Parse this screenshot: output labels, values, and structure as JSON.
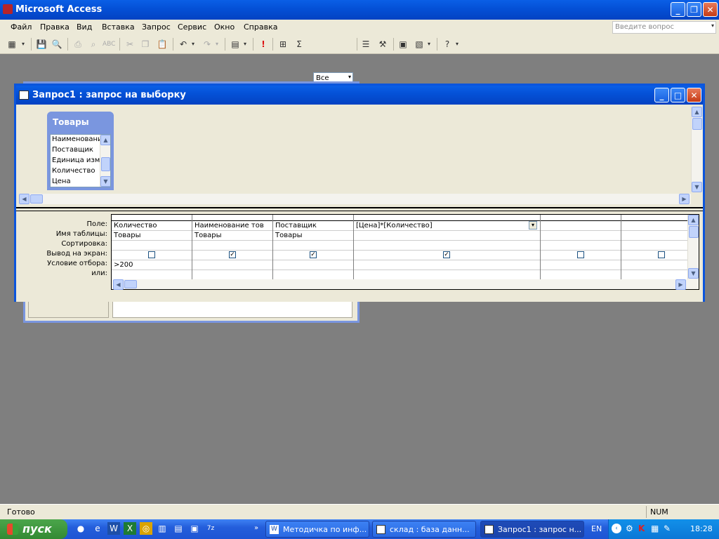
{
  "app": {
    "title": "Microsoft Access"
  },
  "menu": [
    "Файл",
    "Правка",
    "Вид",
    "Вставка",
    "Запрос",
    "Сервис",
    "Окно",
    "Справка"
  ],
  "help_box": {
    "placeholder": "Введите вопрос"
  },
  "toolbar": {
    "top_values": "Все"
  },
  "query_window": {
    "title": "Запрос1 : запрос на выборку",
    "table": {
      "name": "Товары",
      "fields": [
        "Наименование",
        "Поставщик",
        "Единица изме",
        "Количество",
        "Цена"
      ]
    },
    "row_labels": [
      "Поле:",
      "Имя таблицы:",
      "Сортировка:",
      "Вывод на экран:",
      "Условие отбора:",
      "или:"
    ],
    "columns": [
      {
        "field": "Количество",
        "table": "Товары",
        "show": false,
        "criteria": ">200"
      },
      {
        "field": "Наименование тов",
        "table": "Товары",
        "show": true,
        "criteria": ""
      },
      {
        "field": "Поставщик",
        "table": "Товары",
        "show": true,
        "criteria": ""
      },
      {
        "field": "[Цена]*[Количество]",
        "table": "",
        "show": true,
        "criteria": ""
      },
      {
        "field": "",
        "table": "",
        "show": false,
        "criteria": ""
      },
      {
        "field": "",
        "table": "",
        "show": false,
        "criteria": ""
      }
    ]
  },
  "status": {
    "text": "Готово",
    "num": "NUM"
  },
  "taskbar": {
    "start": "пуск",
    "tasks": [
      "Методичка по инф...",
      "склад : база данн...",
      "Запрос1 : запрос н..."
    ],
    "lang": "EN",
    "clock": "18:28"
  }
}
